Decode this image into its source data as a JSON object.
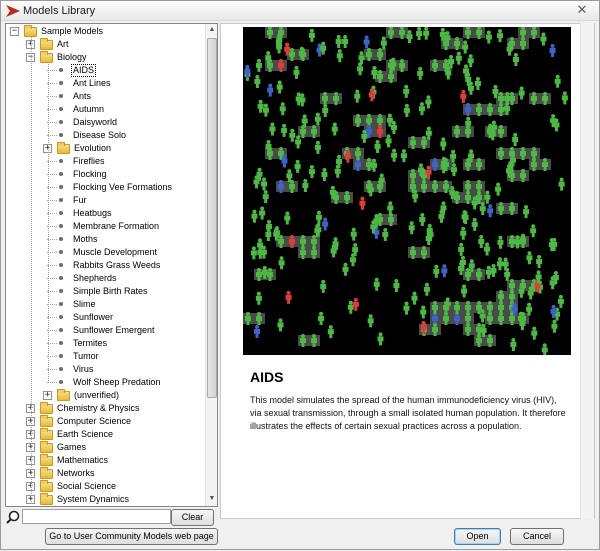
{
  "window": {
    "title": "Models Library",
    "close_glyph": "✕",
    "accent": "#c0271b"
  },
  "tree": {
    "root": "Sample Models",
    "items": [
      {
        "label": "Art",
        "kind": "folder",
        "level": 1,
        "expander": "+"
      },
      {
        "label": "Biology",
        "kind": "folder",
        "level": 1,
        "expander": "−"
      },
      {
        "label": "AIDS",
        "kind": "leaf",
        "level": 2,
        "selected": true
      },
      {
        "label": "Ant Lines",
        "kind": "leaf",
        "level": 2
      },
      {
        "label": "Ants",
        "kind": "leaf",
        "level": 2
      },
      {
        "label": "Autumn",
        "kind": "leaf",
        "level": 2
      },
      {
        "label": "Daisyworld",
        "kind": "leaf",
        "level": 2
      },
      {
        "label": "Disease Solo",
        "kind": "leaf",
        "level": 2
      },
      {
        "label": "Evolution",
        "kind": "folder",
        "level": 2,
        "expander": "+"
      },
      {
        "label": "Fireflies",
        "kind": "leaf",
        "level": 2
      },
      {
        "label": "Flocking",
        "kind": "leaf",
        "level": 2
      },
      {
        "label": "Flocking Vee Formations",
        "kind": "leaf",
        "level": 2
      },
      {
        "label": "Fur",
        "kind": "leaf",
        "level": 2
      },
      {
        "label": "Heatbugs",
        "kind": "leaf",
        "level": 2
      },
      {
        "label": "Membrane Formation",
        "kind": "leaf",
        "level": 2
      },
      {
        "label": "Moths",
        "kind": "leaf",
        "level": 2
      },
      {
        "label": "Muscle Development",
        "kind": "leaf",
        "level": 2
      },
      {
        "label": "Rabbits Grass Weeds",
        "kind": "leaf",
        "level": 2
      },
      {
        "label": "Shepherds",
        "kind": "leaf",
        "level": 2
      },
      {
        "label": "Simple Birth Rates",
        "kind": "leaf",
        "level": 2
      },
      {
        "label": "Slime",
        "kind": "leaf",
        "level": 2
      },
      {
        "label": "Sunflower",
        "kind": "leaf",
        "level": 2
      },
      {
        "label": "Sunflower Emergent",
        "kind": "leaf",
        "level": 2
      },
      {
        "label": "Termites",
        "kind": "leaf",
        "level": 2
      },
      {
        "label": "Tumor",
        "kind": "leaf",
        "level": 2
      },
      {
        "label": "Virus",
        "kind": "leaf",
        "level": 2
      },
      {
        "label": "Wolf Sheep Predation",
        "kind": "leaf",
        "level": 2
      },
      {
        "label": "(unverified)",
        "kind": "folder",
        "level": 2,
        "expander": "+"
      },
      {
        "label": "Chemistry & Physics",
        "kind": "folder",
        "level": 1,
        "expander": "+"
      },
      {
        "label": "Computer Science",
        "kind": "folder",
        "level": 1,
        "expander": "+"
      },
      {
        "label": "Earth Science",
        "kind": "folder",
        "level": 1,
        "expander": "+"
      },
      {
        "label": "Games",
        "kind": "folder",
        "level": 1,
        "expander": "+"
      },
      {
        "label": "Mathematics",
        "kind": "folder",
        "level": 1,
        "expander": "+"
      },
      {
        "label": "Networks",
        "kind": "folder",
        "level": 1,
        "expander": "+"
      },
      {
        "label": "Social Science",
        "kind": "folder",
        "level": 1,
        "expander": "+"
      },
      {
        "label": "System Dynamics",
        "kind": "folder",
        "level": 1,
        "expander": "+"
      }
    ]
  },
  "search": {
    "value": "",
    "clear_label": "Clear"
  },
  "model": {
    "title": "AIDS",
    "description": "This model simulates the spread of the human immunodeficiency virus (HIV), via sexual transmission, through a small isolated human population. It therefore illustrates the effects of certain sexual practices across a population.",
    "view_colors": {
      "background": "#000000",
      "healthy": "#4cb943",
      "infected": "#e03a3a",
      "known": "#3c63c9",
      "couple_patch": "#4a4a4a"
    }
  },
  "footer": {
    "community_label": "Go to User Community Models web page",
    "open_label": "Open",
    "cancel_label": "Cancel"
  }
}
